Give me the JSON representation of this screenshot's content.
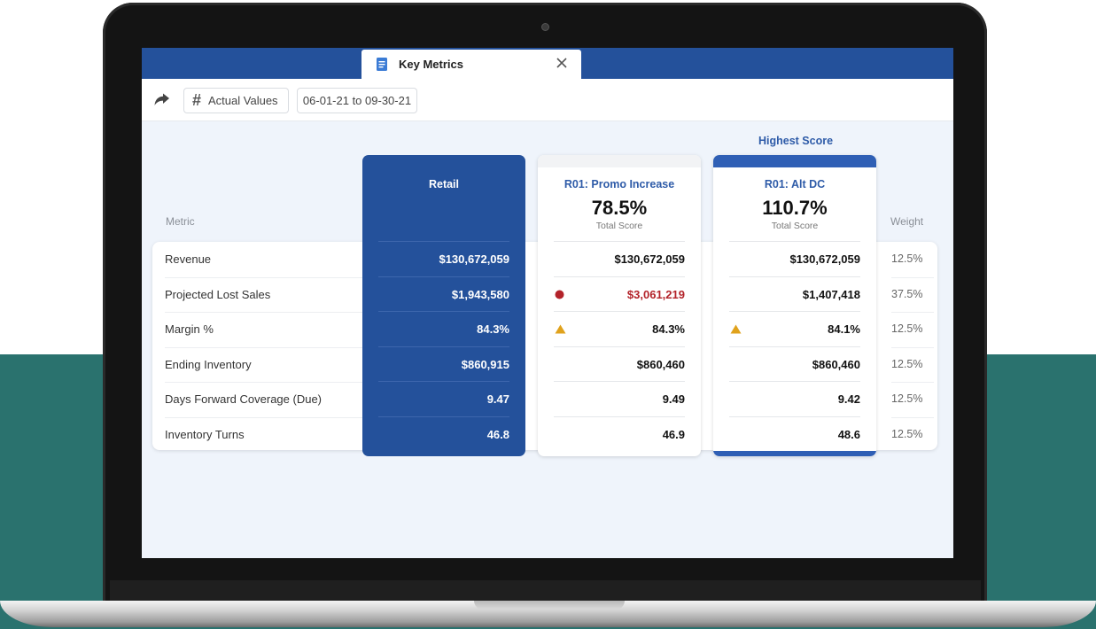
{
  "app": {
    "tab_title": "Key Metrics"
  },
  "toolbar": {
    "values_label": "Actual Values",
    "date_range": "06-01-21 to 09-30-21"
  },
  "headers": {
    "metric": "Metric",
    "weight": "Weight",
    "highest_score": "Highest Score"
  },
  "columns": [
    {
      "name": "Retail"
    },
    {
      "name": "R01: Promo Increase",
      "score": "78.5%",
      "score_label": "Total Score"
    },
    {
      "name": "R01: Alt DC",
      "score": "110.7%",
      "score_label": "Total Score"
    }
  ],
  "rows": [
    {
      "metric": "Revenue",
      "weight": "12.5%",
      "retail": "$130,672,059",
      "promo": "$130,672,059",
      "alt": "$130,672,059",
      "promo_indicator": "",
      "alt_indicator": ""
    },
    {
      "metric": "Projected Lost Sales",
      "weight": "37.5%",
      "retail": "$1,943,580",
      "promo": "$3,061,219",
      "alt": "$1,407,418",
      "promo_indicator": "red-dot-icon",
      "alt_indicator": ""
    },
    {
      "metric": "Margin %",
      "weight": "12.5%",
      "retail": "84.3%",
      "promo": "84.3%",
      "alt": "84.1%",
      "promo_indicator": "warning-triangle-icon",
      "alt_indicator": "warning-triangle-icon"
    },
    {
      "metric": "Ending Inventory",
      "weight": "12.5%",
      "retail": "$860,915",
      "promo": "$860,460",
      "alt": "$860,460",
      "promo_indicator": "",
      "alt_indicator": ""
    },
    {
      "metric": "Days Forward Coverage (Due)",
      "weight": "12.5%",
      "retail": "9.47",
      "promo": "9.49",
      "alt": "9.42",
      "promo_indicator": "",
      "alt_indicator": ""
    },
    {
      "metric": "Inventory Turns",
      "weight": "12.5%",
      "retail": "46.8",
      "promo": "46.9",
      "alt": "48.6",
      "promo_indicator": "",
      "alt_indicator": ""
    }
  ],
  "colors": {
    "brand_blue": "#24519b",
    "accent_blue": "#2f5fb5",
    "alert_red": "#b3232a",
    "warning_amber": "#e0a21c",
    "background_teal": "#2a726e"
  }
}
